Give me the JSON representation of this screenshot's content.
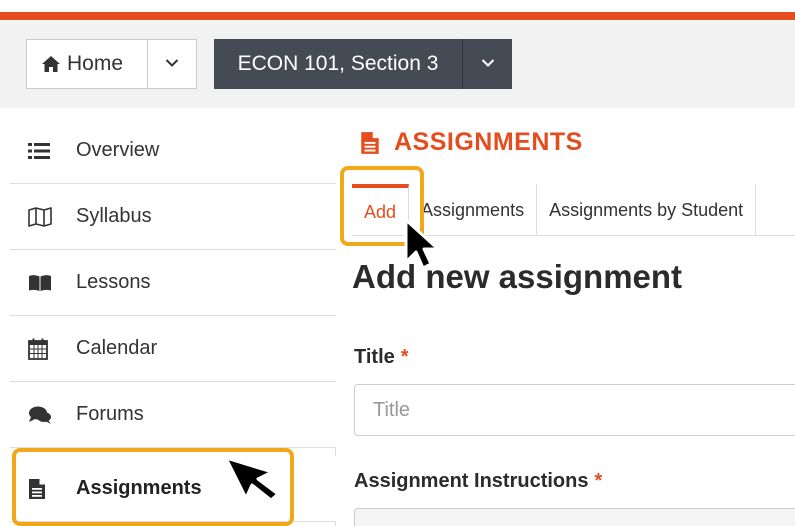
{
  "header": {
    "home_label": "Home",
    "course_label": "ECON 101, Section 3"
  },
  "sidebar": {
    "items": [
      {
        "label": "Overview",
        "icon": "list-icon"
      },
      {
        "label": "Syllabus",
        "icon": "map-icon"
      },
      {
        "label": "Lessons",
        "icon": "book-icon"
      },
      {
        "label": "Calendar",
        "icon": "calendar-icon"
      },
      {
        "label": "Forums",
        "icon": "comments-icon"
      },
      {
        "label": "Assignments",
        "icon": "file-text-icon",
        "active": true
      }
    ]
  },
  "main": {
    "section_title": "ASSIGNMENTS",
    "tabs": [
      {
        "label": "Add",
        "active": true
      },
      {
        "label": "Assignments"
      },
      {
        "label": "Assignments by Student"
      }
    ],
    "heading": "Add new assignment",
    "title_field": {
      "label": "Title",
      "required_mark": "*",
      "placeholder": "Title",
      "value": ""
    },
    "instructions_field": {
      "label": "Assignment Instructions",
      "required_mark": "*"
    }
  },
  "colors": {
    "accent": "#e44e1f",
    "highlight": "#f0a81a",
    "course_button": "#454b54"
  }
}
